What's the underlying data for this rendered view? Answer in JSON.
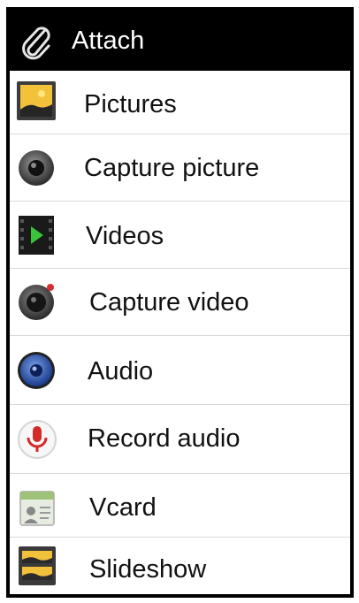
{
  "menu": {
    "title": "Attach",
    "title_icon": "paperclip-icon",
    "items": [
      {
        "label": "Pictures",
        "icon": "pictures-icon"
      },
      {
        "label": "Capture picture",
        "icon": "camera-icon"
      },
      {
        "label": "Videos",
        "icon": "videos-icon"
      },
      {
        "label": "Capture video",
        "icon": "video-camera-icon"
      },
      {
        "label": "Audio",
        "icon": "audio-icon"
      },
      {
        "label": "Record audio",
        "icon": "microphone-icon"
      },
      {
        "label": "Vcard",
        "icon": "vcard-icon"
      },
      {
        "label": "Slideshow",
        "icon": "slideshow-icon"
      }
    ]
  }
}
